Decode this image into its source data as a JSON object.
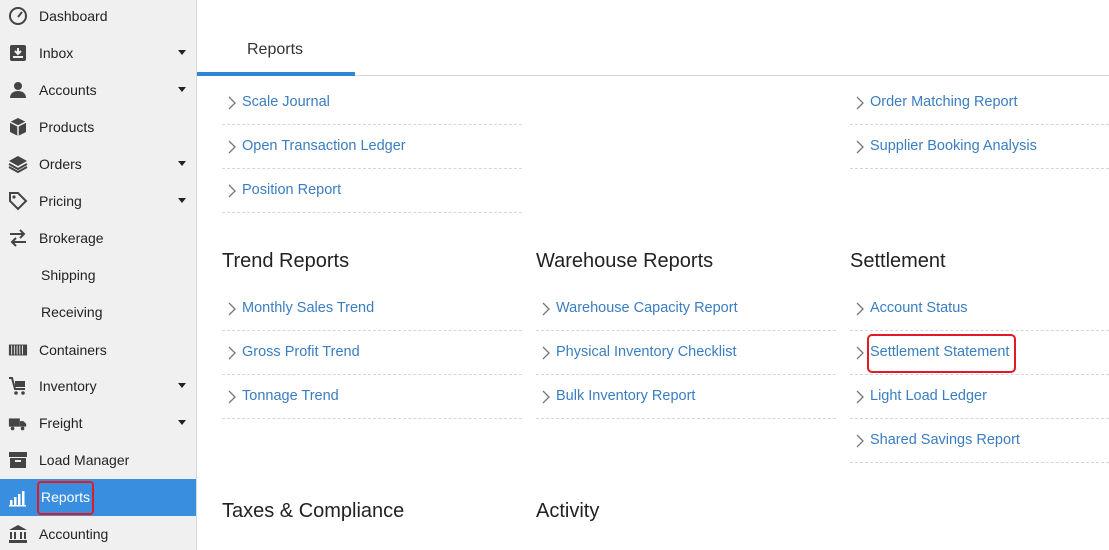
{
  "sidebar": {
    "items": [
      {
        "label": "Dashboard",
        "icon": "gauge-icon",
        "caret": false
      },
      {
        "label": "Inbox",
        "icon": "inbox-icon",
        "caret": true
      },
      {
        "label": "Accounts",
        "icon": "user-icon",
        "caret": true
      },
      {
        "label": "Products",
        "icon": "box-icon",
        "caret": false
      },
      {
        "label": "Orders",
        "icon": "layers-icon",
        "caret": true
      },
      {
        "label": "Pricing",
        "icon": "tag-icon",
        "caret": true
      },
      {
        "label": "Brokerage",
        "icon": "swap-arrows-icon",
        "caret": false
      },
      {
        "label": "Shipping",
        "icon": "",
        "caret": false
      },
      {
        "label": "Receiving",
        "icon": "",
        "caret": false
      },
      {
        "label": "Containers",
        "icon": "container-icon",
        "caret": false
      },
      {
        "label": "Inventory",
        "icon": "cart-icon",
        "caret": true
      },
      {
        "label": "Freight",
        "icon": "truck-icon",
        "caret": true
      },
      {
        "label": "Load Manager",
        "icon": "archive-icon",
        "caret": false
      },
      {
        "label": "Reports",
        "icon": "bar-chart-icon",
        "caret": false,
        "active": true
      },
      {
        "label": "Accounting",
        "icon": "bank-icon",
        "caret": false
      }
    ]
  },
  "tabs": {
    "active_label": "Reports"
  },
  "columns": {
    "col1": {
      "top_links": [
        "Scale Journal",
        "Open Transaction Ledger",
        "Position Report"
      ],
      "trend": {
        "title": "Trend Reports",
        "links": [
          "Monthly Sales Trend",
          "Gross Profit Trend",
          "Tonnage Trend"
        ]
      },
      "taxes": {
        "title": "Taxes & Compliance"
      }
    },
    "col2": {
      "warehouse": {
        "title": "Warehouse Reports",
        "links": [
          "Warehouse Capacity Report",
          "Physical Inventory Checklist",
          "Bulk Inventory Report"
        ]
      },
      "activity": {
        "title": "Activity"
      }
    },
    "col3": {
      "top_links": [
        "Order Matching Report",
        "Supplier Booking Analysis"
      ],
      "settlement": {
        "title": "Settlement",
        "links": [
          "Account Status",
          "Settlement Statement",
          "Light Load Ledger",
          "Shared Savings Report"
        ]
      }
    }
  },
  "colors": {
    "accent": "#2e86d4",
    "active_bg": "#3a8ee0",
    "link": "#3a7dc1",
    "highlight": "#e01b24"
  }
}
